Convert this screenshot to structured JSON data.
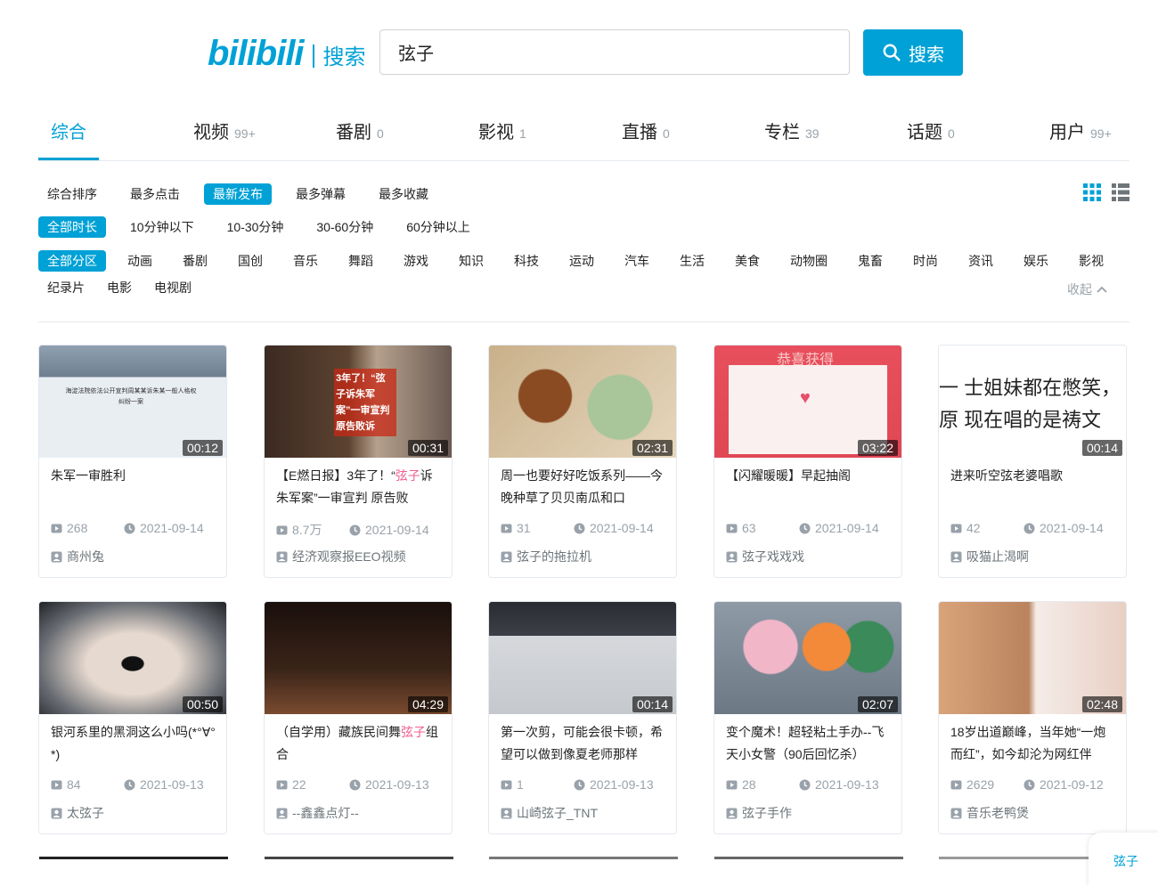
{
  "header": {
    "logo_text": "bilibili",
    "logo_sub": "搜索",
    "search_value": "弦子",
    "search_button": "搜索"
  },
  "tabs": [
    {
      "label": "综合",
      "count": ""
    },
    {
      "label": "视频",
      "count": "99+"
    },
    {
      "label": "番剧",
      "count": "0"
    },
    {
      "label": "影视",
      "count": "1"
    },
    {
      "label": "直播",
      "count": "0"
    },
    {
      "label": "专栏",
      "count": "39"
    },
    {
      "label": "话题",
      "count": "0"
    },
    {
      "label": "用户",
      "count": "99+"
    }
  ],
  "sort_options": [
    "综合排序",
    "最多点击",
    "最新发布",
    "最多弹幕",
    "最多收藏"
  ],
  "duration_options": [
    "全部时长",
    "10分钟以下",
    "10-30分钟",
    "30-60分钟",
    "60分钟以上"
  ],
  "category_options_row1": [
    "全部分区",
    "动画",
    "番剧",
    "国创",
    "音乐",
    "舞蹈",
    "游戏",
    "知识",
    "科技",
    "运动",
    "汽车",
    "生活",
    "美食",
    "动物圈",
    "鬼畜",
    "时尚",
    "资讯",
    "娱乐",
    "影视"
  ],
  "category_options_row2": [
    "纪录片",
    "电影",
    "电视剧"
  ],
  "collapse_label": "收起",
  "videos": [
    {
      "title": "朱军一审胜利",
      "title_rest": "",
      "title_hl": "",
      "duration": "00:12",
      "views": "268",
      "date": "2021-09-14",
      "uploader": "商州兔",
      "thumb_text": "海淀法院依法公开宣判周某某诉朱某一般人格权纠纷一案"
    },
    {
      "title": "【E燃日报】3年了！“",
      "title_hl": "弦子",
      "title_rest": "诉朱军案”一审宣判 原告败",
      "duration": "00:31",
      "views": "8.7万",
      "date": "2021-09-14",
      "uploader": "经济观察报EEO视频",
      "thumb_text": "3年了！“弦子诉朱军案”一审宣判 原告败诉"
    },
    {
      "title": "周一也要好好吃饭系列——今晚种草了贝贝南瓜和口",
      "title_hl": "",
      "title_rest": "",
      "duration": "02:31",
      "views": "31",
      "date": "2021-09-14",
      "uploader": "弦子的拖拉机",
      "thumb_text": ""
    },
    {
      "title": "【闪耀暖暖】早起抽阁",
      "title_hl": "",
      "title_rest": "",
      "duration": "03:22",
      "views": "63",
      "date": "2021-09-14",
      "uploader": "弦子戏戏戏",
      "thumb_text": "恭喜获得"
    },
    {
      "title": "进来听空弦老婆唱歌",
      "title_hl": "",
      "title_rest": "",
      "duration": "00:14",
      "views": "42",
      "date": "2021-09-14",
      "uploader": "吸猫止渴啊",
      "thumb_text": "一 士姐妹都在憋笑，原 现在唱的是祷文"
    },
    {
      "title": "银河系里的黑洞这么小吗(*°∀°*)",
      "title_hl": "",
      "title_rest": "",
      "duration": "00:50",
      "views": "84",
      "date": "2021-09-13",
      "uploader": "太弦子",
      "thumb_text": ""
    },
    {
      "title": "（自学用）藏族民间舞",
      "title_hl": "弦子",
      "title_rest": "组合",
      "duration": "04:29",
      "views": "22",
      "date": "2021-09-13",
      "uploader": "--鑫鑫点灯--",
      "thumb_text": ""
    },
    {
      "title": "第一次剪，可能会很卡顿，希望可以做到像夏老师那样",
      "title_hl": "",
      "title_rest": "",
      "duration": "00:14",
      "views": "1",
      "date": "2021-09-13",
      "uploader": "山崎弦子_TNT",
      "thumb_text": ""
    },
    {
      "title": "变个魔术！超轻粘土手办--飞天小女警（90后回忆杀）",
      "title_hl": "",
      "title_rest": "",
      "duration": "02:07",
      "views": "28",
      "date": "2021-09-13",
      "uploader": "弦子手作",
      "thumb_text": ""
    },
    {
      "title": "18岁出道巅峰，当年她“一炮而红”，如今却沦为网红伴",
      "title_hl": "",
      "title_rest": "",
      "duration": "02:48",
      "views": "2629",
      "date": "2021-09-12",
      "uploader": "音乐老鸭煲",
      "thumb_text": ""
    }
  ],
  "fab_label": "弦子",
  "colors": {
    "accent": "#00a1d6",
    "highlight": "#f25d8e",
    "muted": "#99a2aa"
  }
}
